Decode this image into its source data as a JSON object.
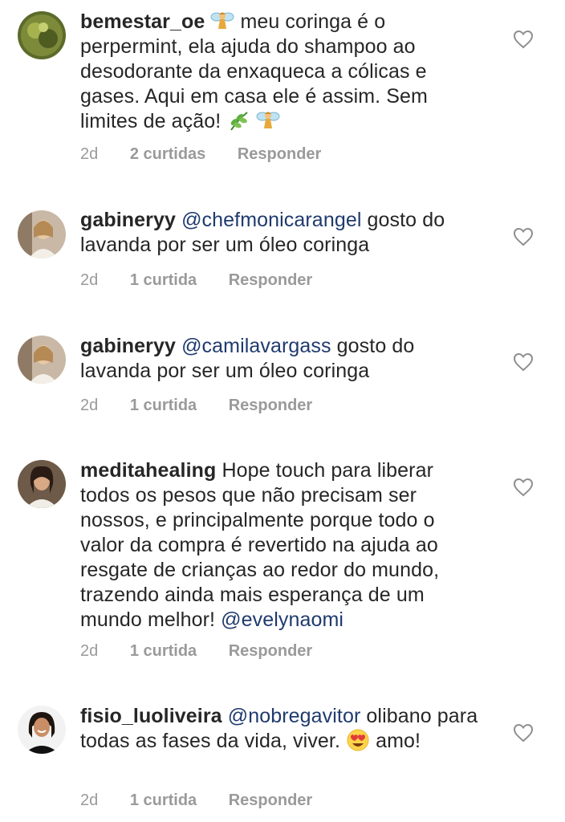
{
  "comments": [
    {
      "username": "bemestar_oe",
      "text_parts": [
        "meu coringa é  o perpermint,  ela ajuda do shampoo ao desodorante da enxaqueca a cólicas e gases. Aqui em casa ele é assim. Sem limites de ação! "
      ],
      "mention": "",
      "time": "2d",
      "likes": "2 curtidas",
      "reply": "Responder",
      "avatar_icon": "plant-avatar"
    },
    {
      "username": "gabineryy",
      "mention": "@chefmonicarangel",
      "text": "gosto do lavanda por ser um óleo coringa",
      "time": "2d",
      "likes": "1 curtida",
      "reply": "Responder",
      "avatar_icon": "woman-avatar"
    },
    {
      "username": "gabineryy",
      "mention": "@camilavargass",
      "text": "gosto do lavanda por ser um óleo coringa",
      "time": "2d",
      "likes": "1 curtida",
      "reply": "Responder",
      "avatar_icon": "woman-avatar"
    },
    {
      "username": "meditahealing",
      "text": "Hope touch para liberar todos os pesos que não precisam ser nossos, e principalmente porque todo o valor da compra é revertido na ajuda ao resgate de crianças ao redor do mundo, trazendo ainda mais esperança de um mundo melhor!",
      "mention": "@evelynaomi",
      "time": "2d",
      "likes": "1 curtida",
      "reply": "Responder",
      "avatar_icon": "woman-dark-hair-avatar"
    },
    {
      "username": "fisio_luoliveira",
      "mention": "@nobregavitor",
      "text": "olibano para todas as fases da vida, viver.",
      "text_after": "amo!",
      "time": "2d",
      "likes": "1 curtida",
      "reply": "Responder",
      "avatar_icon": "woman-smiling-avatar"
    }
  ],
  "colors": {
    "text": "#262626",
    "mention": "#1f3a6e",
    "meta": "#9a9a9a",
    "heart": "#8e8e8e"
  },
  "icons": [
    "fairy-emoji",
    "herb-emoji",
    "heart-eyes-emoji",
    "heart-outline-icon"
  ]
}
